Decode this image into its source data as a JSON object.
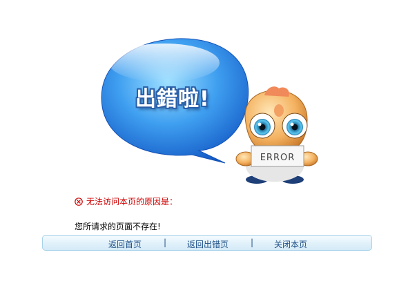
{
  "illustration": {
    "bubble_text": "出錯啦!",
    "sign_text": "ERROR"
  },
  "error": {
    "reason_heading": "无法访问本页的原因是：",
    "message": "您所请求的页面不存在!"
  },
  "actions": {
    "home": "返回首页",
    "back": "返回出错页",
    "close": "关闭本页",
    "separator": "|"
  },
  "colors": {
    "accent_red": "#cc0000",
    "link_blue": "#1f4f86",
    "bar_border": "#a9d2ea"
  }
}
